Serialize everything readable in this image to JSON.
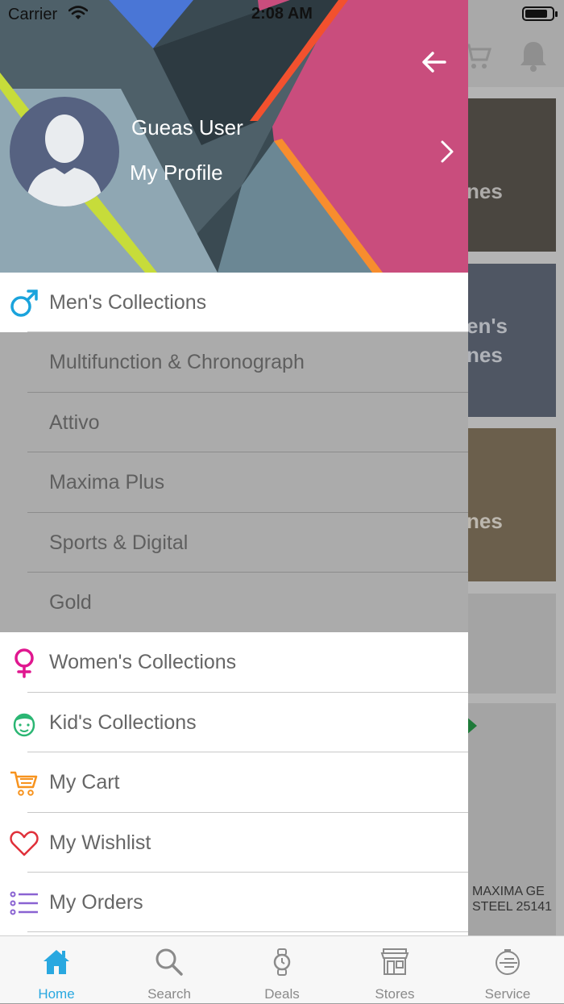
{
  "status_bar": {
    "carrier": "Carrier",
    "time": "2:08 AM"
  },
  "drawer": {
    "user_name": "Gueas User",
    "profile_label": "My Profile",
    "menu": [
      {
        "label": "Men's Collections",
        "icon": "male-symbol-icon",
        "color": "#1aa3dc",
        "sub": false
      },
      {
        "label": "Multifunction & Chronograph",
        "sub": true
      },
      {
        "label": "Attivo",
        "sub": true
      },
      {
        "label": "Maxima Plus",
        "sub": true
      },
      {
        "label": "Sports & Digital",
        "sub": true
      },
      {
        "label": "Gold",
        "sub": true
      },
      {
        "label": "Women's Collections",
        "icon": "female-symbol-icon",
        "color": "#e0178f",
        "sub": false
      },
      {
        "label": "Kid's Collections",
        "icon": "kid-face-icon",
        "color": "#2bb673",
        "sub": false
      },
      {
        "label": "My Cart",
        "icon": "cart-icon",
        "color": "#f7931e",
        "sub": false
      },
      {
        "label": "My Wishlist",
        "icon": "heart-icon",
        "color": "#e0303a",
        "sub": false
      },
      {
        "label": "My Orders",
        "icon": "list-icon",
        "color": "#8a63d2",
        "sub": false
      }
    ]
  },
  "background": {
    "card_texts": [
      "nes",
      "en's",
      "nes",
      "nes"
    ],
    "product_text": [
      "MAXIMA GE",
      "STEEL 25141"
    ]
  },
  "tabbar": {
    "tabs": [
      {
        "label": "Home",
        "icon": "home-icon",
        "active": true
      },
      {
        "label": "Search",
        "icon": "search-icon",
        "active": false
      },
      {
        "label": "Deals",
        "icon": "watch-icon",
        "active": false
      },
      {
        "label": "Stores",
        "icon": "store-icon",
        "active": false
      },
      {
        "label": "Service",
        "icon": "service-icon",
        "active": false
      }
    ]
  },
  "colors": {
    "accent": "#29a8e0",
    "submenu_bg": "#ababab"
  }
}
